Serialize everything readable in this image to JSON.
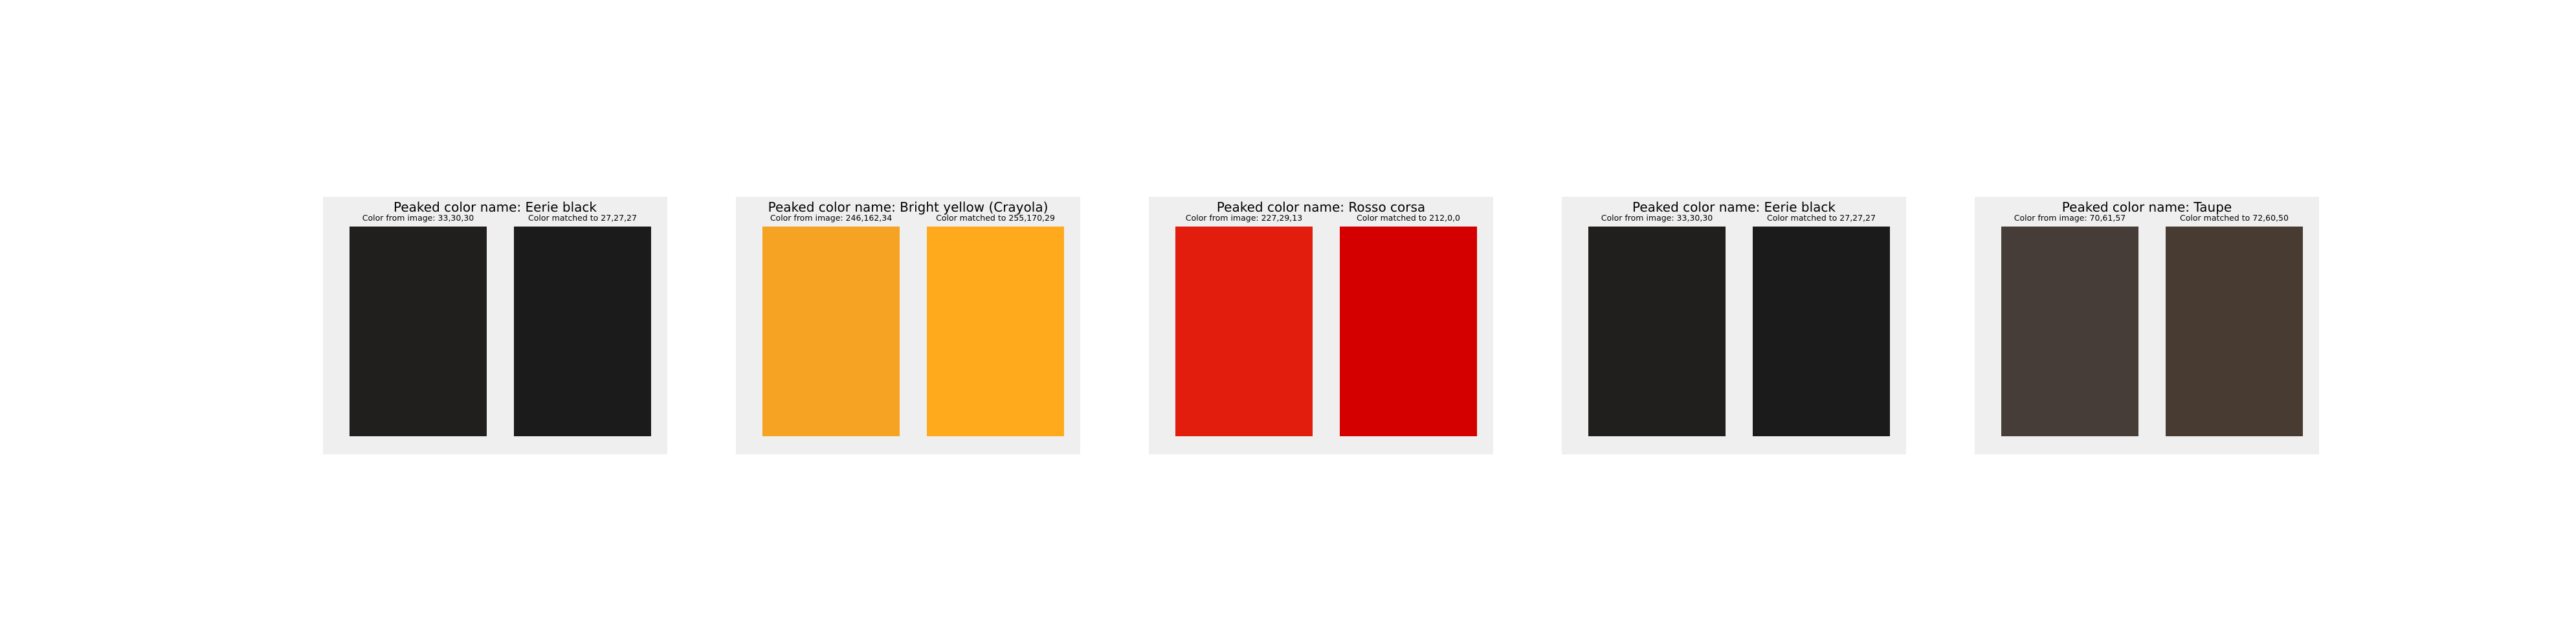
{
  "panels": [
    {
      "title": "Peaked color name: Eerie black",
      "image_label": "Color from image: 33,30,30",
      "matched_label": "Color matched to 27,27,27",
      "image_color": "#211e1e",
      "matched_color": "#1b1b1b"
    },
    {
      "title": "Peaked color name: Bright yellow (Crayola)",
      "image_label": "Color from image: 246,162,34",
      "matched_label": "Color matched to 255,170,29",
      "image_color": "#f6a222",
      "matched_color": "#ffaa1d"
    },
    {
      "title": "Peaked color name: Rosso corsa",
      "image_label": "Color from image: 227,29,13",
      "matched_label": "Color matched to 212,0,0",
      "image_color": "#e31d0d",
      "matched_color": "#d40000"
    },
    {
      "title": "Peaked color name: Eerie black",
      "image_label": "Color from image: 33,30,30",
      "matched_label": "Color matched to 27,27,27",
      "image_color": "#211e1e",
      "matched_color": "#1b1b1b"
    },
    {
      "title": "Peaked color name: Taupe",
      "image_label": "Color from image: 70,61,57",
      "matched_label": "Color matched to 72,60,50",
      "image_color": "#463d39",
      "matched_color": "#483c32"
    }
  ]
}
